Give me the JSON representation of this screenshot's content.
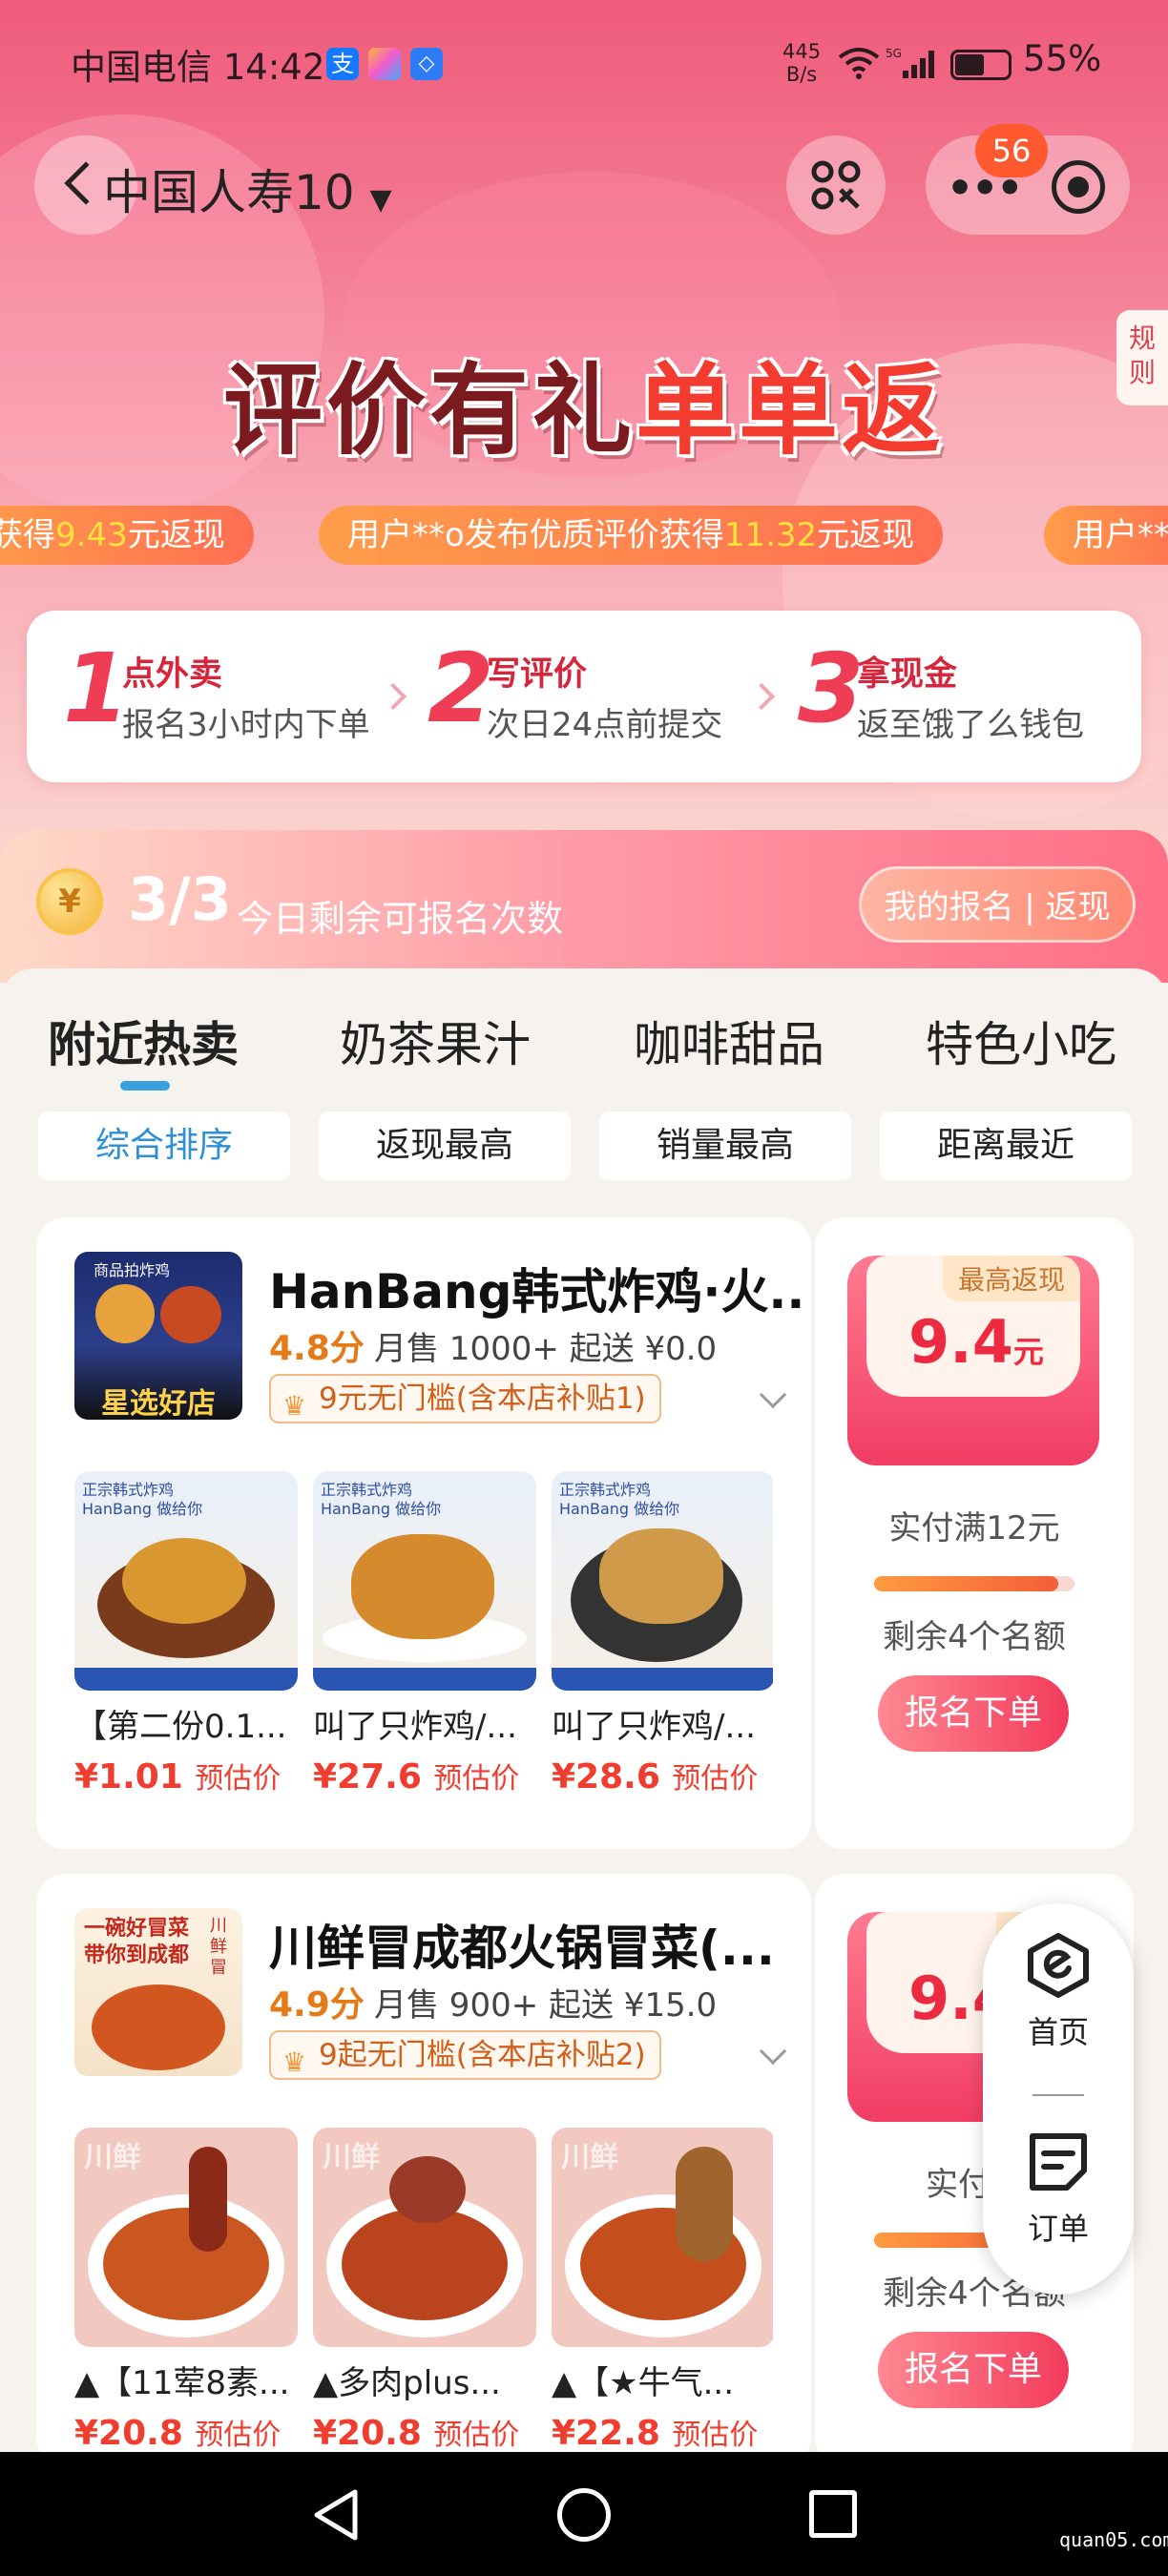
{
  "status_bar": {
    "carrier_time": "中国电信 14:42",
    "speed": "445",
    "speed_unit": "B/s",
    "battery": "55%"
  },
  "nav": {
    "title": "中国人寿10",
    "badge": "56"
  },
  "banner": {
    "title_a": "评价有礼",
    "title_b": "单单返",
    "rules": "规则",
    "ticker": [
      {
        "prefix": "获得",
        "value": "9.43",
        "suffix": "元返现"
      },
      {
        "prefix": "用户**o发布优质评价获得",
        "value": "11.32",
        "suffix": "元返现"
      },
      {
        "prefix": "用户**",
        "value": "",
        "suffix": ""
      }
    ]
  },
  "steps": [
    {
      "num": "1",
      "title": "点外卖",
      "desc": "报名3小时内下单"
    },
    {
      "num": "2",
      "title": "写评价",
      "desc": "次日24点前提交"
    },
    {
      "num": "3",
      "title": "拿现金",
      "desc": "返至饿了么钱包"
    }
  ],
  "quota": {
    "count": "3/3",
    "label": "今日剩余可报名次数",
    "button": "我的报名 | 返现",
    "coin_symbol": "¥"
  },
  "tabs": [
    "附近热卖",
    "奶茶果汁",
    "咖啡甜品",
    "特色小吃"
  ],
  "sorts": [
    "综合排序",
    "返现最高",
    "销量最高",
    "距离最近"
  ],
  "shops": [
    {
      "name": "HanBang韩式炸鸡·火...",
      "score": "4.8分",
      "sales": "月售 1000+ 起送 ¥0.0",
      "coupon": "9元无门槛(含本店补贴1)",
      "logo_text": "星选好店",
      "logo_top": "商品拍炸鸡",
      "dishes": [
        {
          "name": "【第二份0.1...",
          "price": "¥1.01",
          "label": "预估价"
        },
        {
          "name": "叫了只炸鸡/...",
          "price": "¥27.6",
          "label": "预估价"
        },
        {
          "name": "叫了只炸鸡/...",
          "price": "¥28.6",
          "label": "预估价"
        }
      ],
      "dish_banner": "正宗韩式炸鸡",
      "dish_sub": "HanBang 做给你",
      "cash": {
        "tag": "最高返现",
        "value": "9.4",
        "unit": "元",
        "condition": "实付满12元",
        "remain": "剩余4个名额",
        "progress": 0.92,
        "button": "报名下单"
      }
    },
    {
      "name": "川鲜冒成都火锅冒菜(...",
      "score": "4.9分",
      "sales": "月售 900+ 起送 ¥15.0",
      "coupon": "9起无门槛(含本店补贴2)",
      "logo_text": "一碗好冒菜 带你到成都",
      "logo_top": "川鲜冒",
      "dishes": [
        {
          "name": "▲【11荤8素...",
          "price": "¥20.8",
          "label": "预估价"
        },
        {
          "name": "▲多肉plus...",
          "price": "¥20.8",
          "label": "预估价"
        },
        {
          "name": "▲【★牛气...",
          "price": "¥22.8",
          "label": "预估价"
        }
      ],
      "dish_banner": "川鲜",
      "dish_sub": "",
      "cash": {
        "tag": "最高",
        "value": "9.4",
        "unit": "",
        "condition": "实付满",
        "remain": "剩余4个名额",
        "progress": 0.92,
        "button": "报名下单"
      }
    }
  ],
  "float_menu": {
    "home": "首页",
    "orders": "订单"
  },
  "watermark": "quan05.com"
}
